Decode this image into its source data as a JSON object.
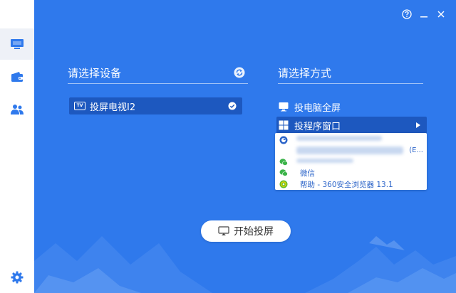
{
  "window_controls": {
    "help_icon": "question-circle-icon",
    "minimize_icon": "minimize-icon",
    "close_icon": "close-icon"
  },
  "sidebar": {
    "items": [
      {
        "icon": "monitor-cast-icon",
        "active": true
      },
      {
        "icon": "wallet-icon",
        "active": false
      },
      {
        "icon": "users-icon",
        "active": false
      }
    ],
    "settings_icon": "gear-icon"
  },
  "device_section": {
    "title": "请选择设备",
    "refresh_icon": "refresh-icon",
    "devices": [
      {
        "badge": "TV",
        "label": "投屏电视I2",
        "selected": true
      }
    ]
  },
  "mode_section": {
    "title": "请选择方式",
    "modes": [
      {
        "icon": "monitor-icon",
        "label": "投电脑全屏",
        "selected": false
      },
      {
        "icon": "windows-grid-icon",
        "label": "投程序窗口",
        "selected": true
      }
    ],
    "windows": [
      {
        "icon": "browser-app-icon",
        "label": "",
        "blurred": true
      },
      {
        "icon": "",
        "label": "",
        "blurred": true,
        "partial": "(E..."
      },
      {
        "icon": "wechat-icon",
        "label": "",
        "blurred": true
      },
      {
        "icon": "wechat-icon",
        "label": "微信",
        "blurred": false
      },
      {
        "icon": "360-browser-icon",
        "label": "帮助 - 360安全浏览器 13.1",
        "blurred": false
      }
    ]
  },
  "start_button": {
    "label": "开始投屏",
    "icon": "screen-cast-icon"
  },
  "colors": {
    "background": "#2f79ec",
    "selected": "#1d58bf",
    "link_text": "#2a63c8"
  }
}
